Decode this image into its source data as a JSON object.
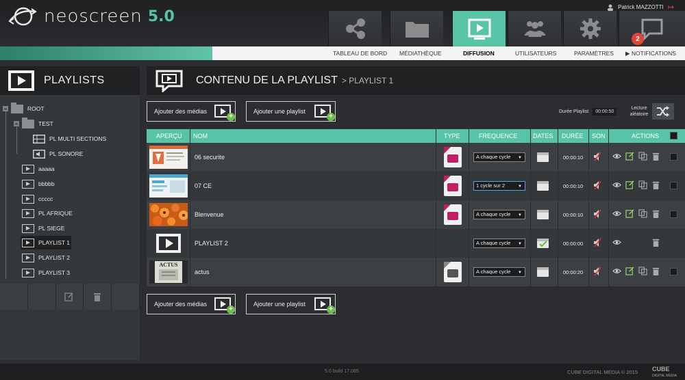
{
  "app": {
    "name": "neoscreen",
    "version": "5.0"
  },
  "user": {
    "name": "Patrick MAZZOTTI"
  },
  "nav": {
    "tabs": [
      {
        "label": "TABLEAU DE BORD",
        "icon": "share-icon"
      },
      {
        "label": "MÉDIATHÈQUE",
        "icon": "folder-icon"
      },
      {
        "label": "DIFFUSION",
        "icon": "play-screen-icon",
        "active": true
      },
      {
        "label": "UTILISATEURS",
        "icon": "users-icon"
      },
      {
        "label": "PARAMÈTRES",
        "icon": "gear-icon"
      },
      {
        "label": "▶ NOTIFICATIONS",
        "icon": "chat-bubble-icon",
        "badge": "2"
      }
    ]
  },
  "left": {
    "title": "PLAYLISTS",
    "tree": [
      {
        "label": "ROOT",
        "type": "folder"
      },
      {
        "label": "TEST",
        "type": "folder"
      },
      {
        "label": "PL MULTI SECTIONS",
        "type": "grid"
      },
      {
        "label": "PL SONORE",
        "type": "sound"
      },
      {
        "label": "aaaaa",
        "type": "playlist"
      },
      {
        "label": "bbbbb",
        "type": "playlist"
      },
      {
        "label": "ccccc",
        "type": "playlist"
      },
      {
        "label": "PL AFRIQUE",
        "type": "playlist"
      },
      {
        "label": "PL SIEGE",
        "type": "playlist"
      },
      {
        "label": "PLAYLIST 1",
        "type": "playlist",
        "selected": true
      },
      {
        "label": "PLAYLIST 2",
        "type": "playlist"
      },
      {
        "label": "PLAYLIST 3",
        "type": "playlist"
      }
    ]
  },
  "main": {
    "title": "CONTENU DE LA PLAYLIST",
    "breadcrumb": "> PLAYLIST 1",
    "add_media": "Ajouter des médias",
    "add_playlist": "Ajouter une playlist",
    "duration_label": "Durée Playlist",
    "duration_value": "00:00:50",
    "random_label": "Lecture aléatoire",
    "columns": [
      "APERÇU",
      "NOM",
      "TYPE",
      "FREQUENCE",
      "DATES",
      "DURÉE",
      "SON",
      "ACTIONS"
    ],
    "rows": [
      {
        "name": "06 securite",
        "frequency": "A chaque cycle",
        "duration": "00:00:10",
        "thumb": "slide-red",
        "type": "image"
      },
      {
        "name": "07 CE",
        "frequency": "1 cycle sur 2",
        "duration": "00:00:10",
        "thumb": "slide-blue",
        "type": "image"
      },
      {
        "name": "Blenvenue",
        "frequency": "A chaque cycle",
        "duration": "00:00:10",
        "thumb": "flowers",
        "type": "image"
      },
      {
        "name": "PLAYLIST 2",
        "frequency": "A chaque cycle",
        "duration": "00:00:00",
        "thumb": "playlist",
        "type": "playlist"
      },
      {
        "name": "actus",
        "frequency": "A chaque cycle",
        "duration": "00:00:20",
        "thumb": "news",
        "type": "image-gray"
      }
    ]
  },
  "footer": {
    "build": "5.0 build 17.085",
    "copyright": "CUBE DIGITAL MEDIA © 2015",
    "brand": "CUBE",
    "brand_sub": "DIGITAL MEDIA"
  },
  "colors": {
    "accent": "#57c4a7",
    "badge": "#e04436",
    "type_tag": "#c01f66"
  }
}
